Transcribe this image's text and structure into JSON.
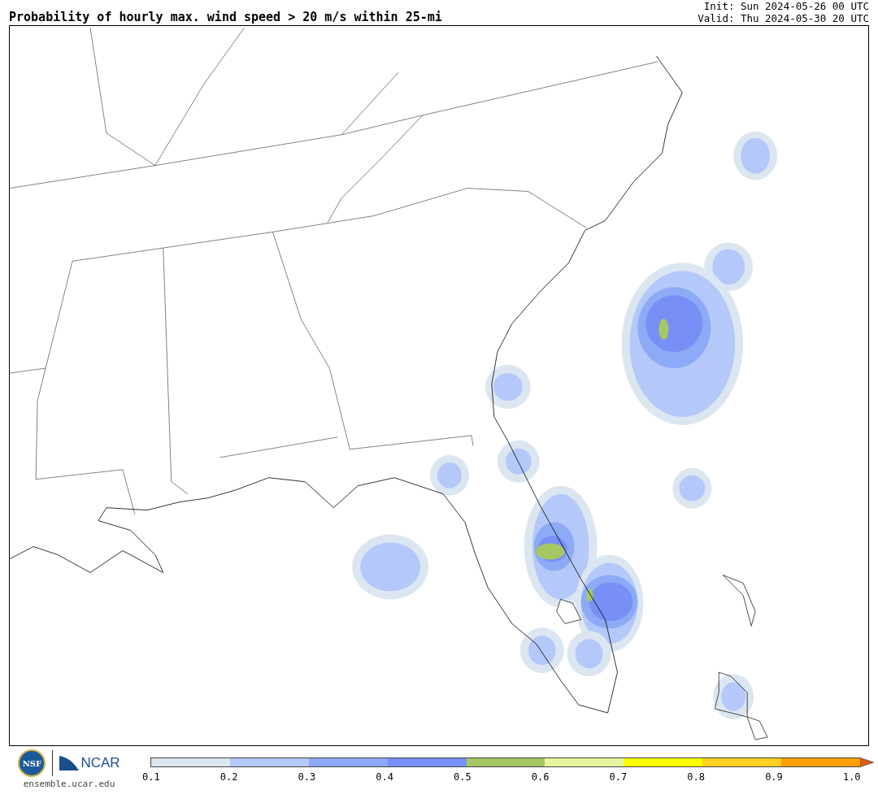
{
  "title": "Probability of hourly max. wind speed > 20 m/s within 25-mi",
  "init": "Init: Sun 2024-05-26 00 UTC",
  "valid": "Valid: Thu 2024-05-30 20 UTC",
  "logos": {
    "nsf": "NSF",
    "ncar": "NCAR",
    "site": "ensemble.ucar.edu"
  },
  "colorbar": {
    "bins": [
      {
        "color": "#dce6f0"
      },
      {
        "color": "#b4c8fa"
      },
      {
        "color": "#8caaf5"
      },
      {
        "color": "#7890f5"
      },
      {
        "color": "#a5c864"
      },
      {
        "color": "#e8f5a0"
      },
      {
        "color": "#ffff00"
      },
      {
        "color": "#ffd020"
      },
      {
        "color": "#ffa000"
      }
    ],
    "extend": {
      "color": "#e85a10"
    },
    "ticks": [
      "0.1",
      "0.2",
      "0.3",
      "0.4",
      "0.5",
      "0.6",
      "0.7",
      "0.8",
      "0.9",
      "1.0"
    ]
  }
}
